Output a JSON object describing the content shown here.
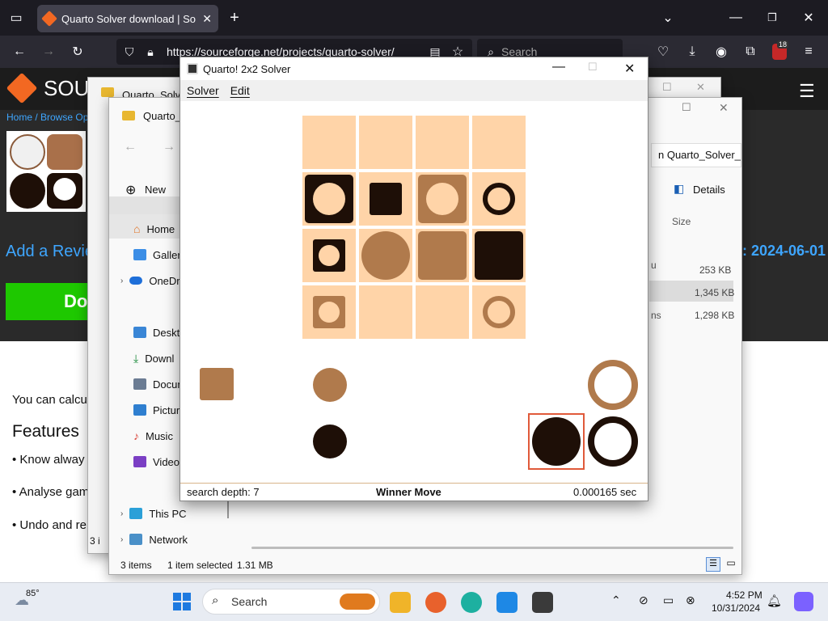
{
  "browser": {
    "tab_title": "Quarto Solver download | Sour",
    "url": "https://sourceforge.net/projects/quarto-solver/",
    "search_placeholder": "Search",
    "badge_count": "18"
  },
  "sourceforge": {
    "logo_text": "SOUR",
    "breadcrumb": "Home / Browse Op",
    "add_review": "Add a Revie",
    "download": "Do",
    "date": ": 2024-06-01",
    "intro": "You can calcu",
    "features_heading": "Features",
    "bullets": [
      "• Know alway",
      "• Analyse gam",
      "• Undo and re"
    ]
  },
  "explorer_back": {
    "title": "Quarto_Solve"
  },
  "explorer": {
    "title": "Quarto_",
    "path_fragment": "n Quarto_Solver_Wi",
    "new_label": "New",
    "details_label": "Details",
    "size_header": "Size",
    "nav": [
      "Home",
      "Gallery",
      "OneDri",
      "Deskto",
      "Downl",
      "Docum",
      "Pictur",
      "Music",
      "Videos",
      "This PC",
      "Network"
    ],
    "files": [
      {
        "name": "u",
        "size": "253 KB"
      },
      {
        "name": "",
        "size": "1,345 KB"
      },
      {
        "name": "ns",
        "size": "1,298 KB"
      }
    ],
    "status_items": "3 items",
    "status_selected": "1 item selected",
    "status_size": "1.31 MB",
    "back_status": "3 i"
  },
  "solver": {
    "title": "Quarto! 2x2 Solver",
    "menu": [
      "Solver",
      "Edit"
    ],
    "status_depth": "search depth: 7",
    "status_result": "Winner Move",
    "status_time": "0.000165 sec",
    "colors": {
      "light": "#ffd4a8",
      "mid": "#b07a4c",
      "dark": "#1e0f07",
      "highlight": "#e05a3a"
    }
  },
  "taskbar": {
    "weather": "85°",
    "search": "Search",
    "time": "4:52 PM",
    "date": "10/31/2024"
  }
}
